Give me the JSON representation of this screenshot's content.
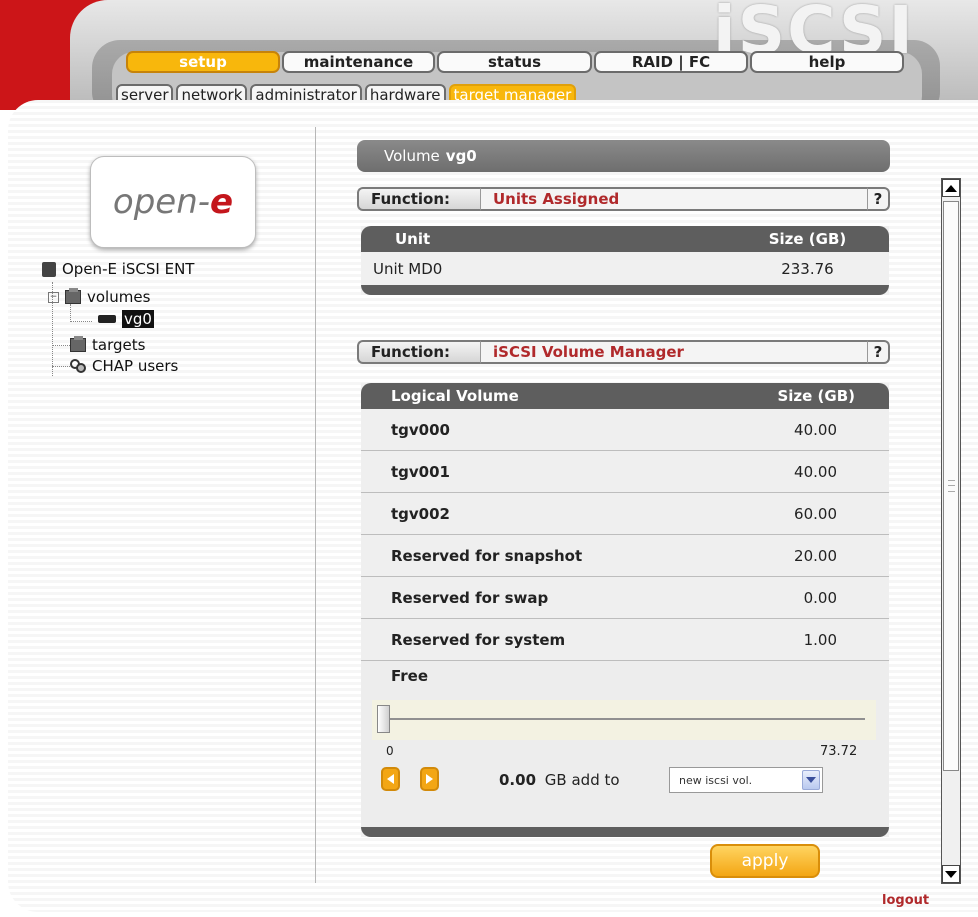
{
  "app": {
    "product_title": "iSCSI"
  },
  "nav": {
    "main_tabs": [
      {
        "label": "setup"
      },
      {
        "label": "maintenance"
      },
      {
        "label": "status"
      },
      {
        "label": "RAID | FC"
      },
      {
        "label": "help"
      }
    ],
    "sub_tabs": [
      {
        "label": "server"
      },
      {
        "label": "network"
      },
      {
        "label": "administrator"
      },
      {
        "label": "hardware"
      },
      {
        "label": "target manager"
      }
    ]
  },
  "brand": {
    "prefix": "open-",
    "suffix": "e"
  },
  "tree": {
    "root": "Open-E iSCSI ENT",
    "volumes": "volumes",
    "vg0": "vg0",
    "targets": "targets",
    "chap": "CHAP users"
  },
  "volume": {
    "prefix": "Volume",
    "name": "vg0"
  },
  "units_function": {
    "label": "Function:",
    "name": "Units Assigned",
    "help": "?"
  },
  "units_table": {
    "headers": {
      "unit": "Unit",
      "size": "Size (GB)"
    },
    "rows": [
      {
        "unit": "Unit MD0",
        "size": "233.76"
      }
    ]
  },
  "volume_function": {
    "label": "Function:",
    "name": "iSCSI Volume Manager",
    "help": "?"
  },
  "lv_table": {
    "headers": {
      "name": "Logical Volume",
      "size": "Size (GB)"
    },
    "rows": [
      {
        "name": "tgv000",
        "size": "40.00"
      },
      {
        "name": "tgv001",
        "size": "40.00"
      },
      {
        "name": "tgv002",
        "size": "60.00"
      },
      {
        "name": "Reserved for snapshot",
        "size": "20.00"
      },
      {
        "name": "Reserved for swap",
        "size": "0.00"
      },
      {
        "name": "Reserved for system",
        "size": "1.00"
      }
    ]
  },
  "free": {
    "label": "Free",
    "min": "0",
    "max": "73.72",
    "slider_value": 0,
    "amount": "0.00",
    "unit_text": "GB add to",
    "target_option": "new iscsi vol."
  },
  "actions": {
    "apply": "apply",
    "logout": "logout"
  },
  "colors": {
    "accent_orange": "#f8b70c",
    "brand_red": "#cc1518",
    "function_red": "#b0292b"
  }
}
